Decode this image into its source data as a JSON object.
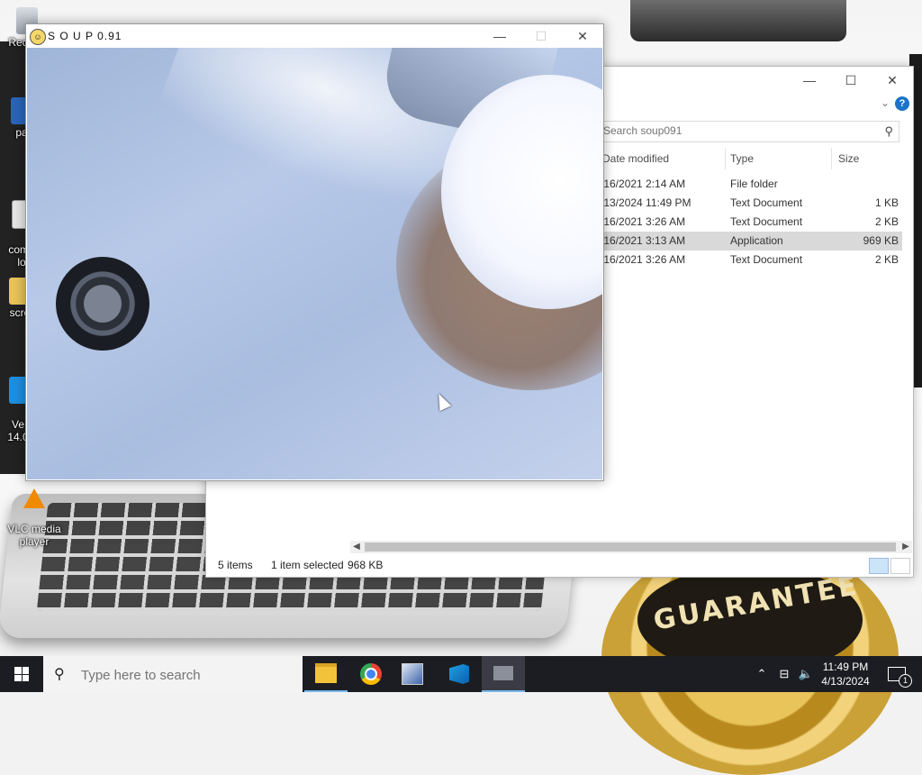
{
  "desktop": {
    "icons": [
      {
        "label": "Rec",
        "icon": "recycle-bin-icon"
      },
      {
        "label": "pa",
        "icon": "shortcut-icon"
      },
      {
        "label": "comp\nlo",
        "icon": "document-icon"
      },
      {
        "label": "scre",
        "icon": "folder-icon"
      },
      {
        "label": "Ve\n14.0",
        "icon": "app-shortcut-icon"
      },
      {
        "label": "VLC media\nplayer",
        "icon": "vlc-icon"
      }
    ],
    "wallpaper_text": "GUARANTEE"
  },
  "soup_window": {
    "title": "S O U P 0.91",
    "controls": {
      "minimize": "—",
      "maximize": "☐",
      "close": "✕"
    }
  },
  "explorer": {
    "controls": {
      "minimize": "—",
      "maximize": "☐",
      "close": "✕"
    },
    "help": "?",
    "ribbon_chevron": "⌄",
    "search_placeholder": "Search soup091",
    "columns": {
      "date": "Date modified",
      "type": "Type",
      "size": "Size"
    },
    "rows": [
      {
        "date": "/16/2021 2:14 AM",
        "type": "File folder",
        "size": "",
        "selected": false
      },
      {
        "date": "/13/2024 11:49 PM",
        "type": "Text Document",
        "size": "1 KB",
        "selected": false
      },
      {
        "date": "/16/2021 3:26 AM",
        "type": "Text Document",
        "size": "2 KB",
        "selected": false
      },
      {
        "date": "/16/2021 3:13 AM",
        "type": "Application",
        "size": "969 KB",
        "selected": true
      },
      {
        "date": "/16/2021 3:26 AM",
        "type": "Text Document",
        "size": "2 KB",
        "selected": false
      }
    ],
    "status": {
      "items": "5 items",
      "selected": "1 item selected",
      "selected_size": "968 KB"
    }
  },
  "taskbar": {
    "search_placeholder": "Type here to search",
    "apps": [
      {
        "name": "file-explorer-icon",
        "active": true
      },
      {
        "name": "chrome-icon",
        "active": false
      },
      {
        "name": "app-icon",
        "active": false
      },
      {
        "name": "visual-studio-icon",
        "active": false
      },
      {
        "name": "soup-taskbar-icon",
        "active": true
      }
    ],
    "clock_time": "11:49 PM",
    "clock_date": "4/13/2024",
    "notification_count": "1"
  },
  "colors": {
    "taskbar": "#1c1d22",
    "selection": "#d9d9d9",
    "accent": "#76b9ed"
  }
}
